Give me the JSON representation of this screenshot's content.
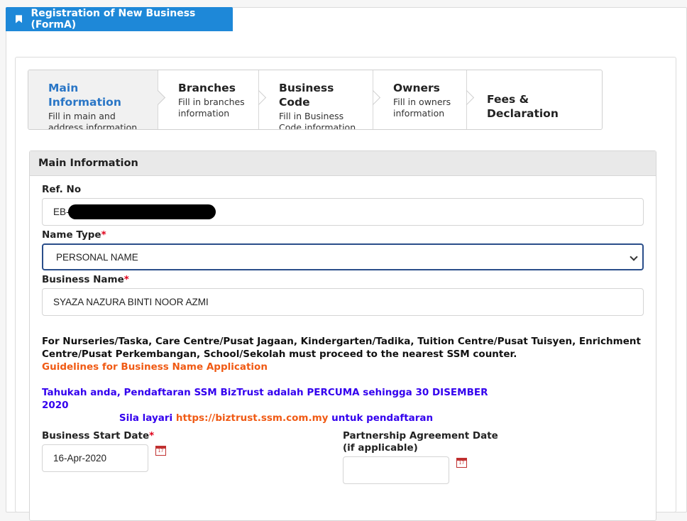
{
  "header": {
    "title": "Registration of New Business (FormA)",
    "icon": "bookmark-icon"
  },
  "steps": [
    {
      "title": "Main Information",
      "sub1": "Fill in main and",
      "sub2": "address information",
      "active": true
    },
    {
      "title": "Branches",
      "sub1": "Fill in branches",
      "sub2": "information"
    },
    {
      "title": "Business Code",
      "sub1": "Fill in Business",
      "sub2": "Code information"
    },
    {
      "title": "Owners",
      "sub1": "Fill in owners",
      "sub2": "information"
    },
    {
      "title": "Fees & Declaration"
    }
  ],
  "section": {
    "title": "Main Information"
  },
  "fields": {
    "ref_no": {
      "label": "Ref. No",
      "value_prefix": "EB-"
    },
    "name_type": {
      "label": "Name Type",
      "required": "*",
      "value": "PERSONAL NAME"
    },
    "business_name": {
      "label": "Business Name",
      "required": "*",
      "value": "SYAZA NAZURA BINTI NOOR AZMI"
    },
    "start_date": {
      "label": "Business Start Date",
      "required": "*",
      "value": "16-Apr-2020"
    },
    "partnership_date": {
      "label_line1": "Partnership Agreement Date",
      "label_line2": "(if applicable)",
      "value": ""
    }
  },
  "notes": {
    "line1": "For Nurseries/Taska, Care Centre/Pusat Jagaan, Kindergarten/Tadika, Tuition Centre/Pusat Tuisyen, Enrichment",
    "line2": "Centre/Pusat Perkembangan, School/Sekolah must proceed to the nearest SSM counter.",
    "guidelines_link": "Guidelines for Business Name Application"
  },
  "notice": {
    "line1": "Tahukah anda, Pendaftaran SSM BizTrust adalah PERCUMA sehingga 30 DISEMBER 2020",
    "line2_pre": "Sila layari ",
    "line2_link": "https://biztrust.ssm.com.my",
    "line2_post": " untuk pendaftaran"
  },
  "colors": {
    "accent": "#1e88d8",
    "active_step": "#2a76c6",
    "required": "#e0001a",
    "link_orange": "#f05a14",
    "notice_blue": "#3300ee"
  }
}
